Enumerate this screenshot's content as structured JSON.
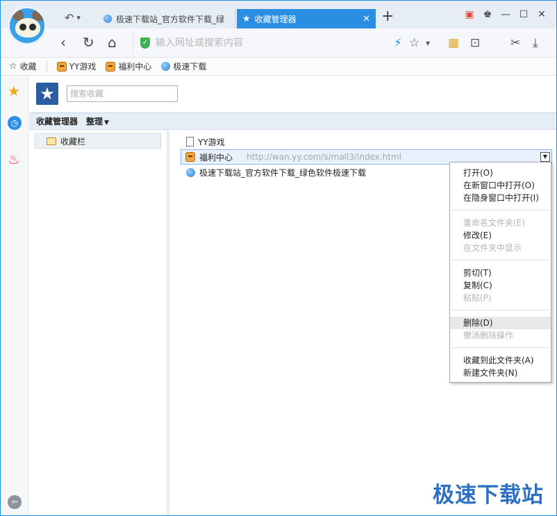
{
  "browser": {
    "tabs": [
      {
        "label": "极速下载站_官方软件下载_绿",
        "active": false
      },
      {
        "label": "收藏管理器",
        "active": true
      }
    ],
    "address_placeholder": "输入网址或搜索内容"
  },
  "bookmarks_bar": {
    "items": [
      {
        "label": "收藏",
        "icon": "star-icon"
      },
      {
        "label": "YY游戏",
        "icon": "tiger-icon"
      },
      {
        "label": "福利中心",
        "icon": "tiger-icon"
      },
      {
        "label": "极速下载",
        "icon": "globe-icon"
      }
    ]
  },
  "manager": {
    "search_placeholder": "搜索收藏",
    "toolbar": {
      "title": "收藏管理器",
      "organize": "整理"
    },
    "tree": [
      {
        "label": "收藏栏"
      }
    ],
    "list": [
      {
        "title": "YY游戏",
        "url": "",
        "icon": "document-icon",
        "selected": false
      },
      {
        "title": "福利中心",
        "url": "http://wan.yy.com/s/mall3/index.html",
        "icon": "tiger-icon",
        "selected": true
      },
      {
        "title": "极速下载站_官方软件下载_绿色软件极速下载",
        "url": "",
        "icon": "globe-icon",
        "selected": false
      }
    ]
  },
  "context_menu": {
    "groups": [
      [
        {
          "label": "打开(O)",
          "enabled": true
        },
        {
          "label": "在新窗口中打开(O)",
          "enabled": true
        },
        {
          "label": "在隐身窗口中打开(I)",
          "enabled": true
        }
      ],
      [
        {
          "label": "重命名文件夹(E)",
          "enabled": false
        },
        {
          "label": "修改(E)",
          "enabled": true
        },
        {
          "label": "在文件夹中显示",
          "enabled": false
        }
      ],
      [
        {
          "label": "剪切(T)",
          "enabled": true
        },
        {
          "label": "复制(C)",
          "enabled": true
        },
        {
          "label": "粘贴(P)",
          "enabled": false
        }
      ],
      [
        {
          "label": "删除(D)",
          "enabled": true,
          "highlighted": true
        },
        {
          "label": "撤消删除操作",
          "enabled": false
        }
      ],
      [
        {
          "label": "收藏到此文件夹(A)",
          "enabled": true
        },
        {
          "label": "新建文件夹(N)",
          "enabled": true
        }
      ]
    ]
  },
  "watermark": "极速下载站",
  "colors": {
    "accent": "#2a8fe3",
    "tab_active": "#2a8fe3",
    "selection": "#e8f1fc",
    "watermark": "#2d6fc2"
  }
}
